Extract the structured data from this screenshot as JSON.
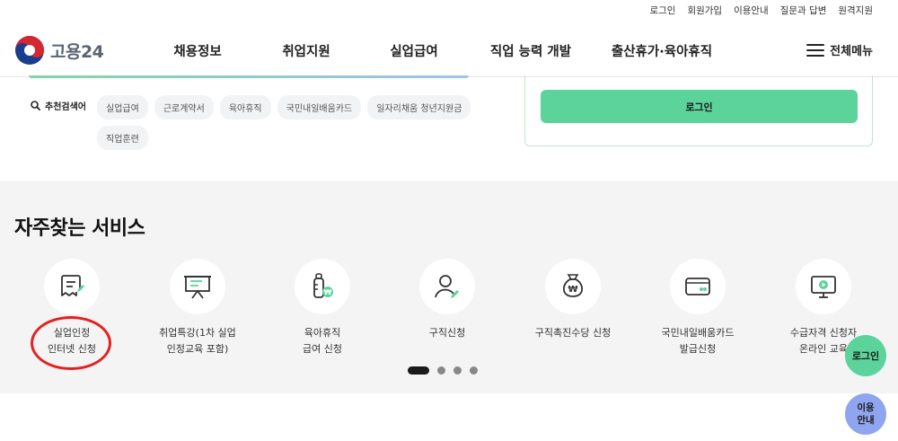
{
  "util_links": [
    "로그인",
    "회원가입",
    "이용안내",
    "질문과 답변",
    "원격지원"
  ],
  "logo": {
    "text": "고용24"
  },
  "gnb": [
    "채용정보",
    "취업지원",
    "실업급여",
    "직업 능력 개발",
    "출산휴가·육아휴직"
  ],
  "all_menu_label": "전체메뉴",
  "recommend": {
    "label": "추천검색어",
    "tags": [
      "실업급여",
      "근로계약서",
      "육아휴직",
      "국민내일배움카드",
      "일자리채움 청년지원금",
      "직업훈련"
    ]
  },
  "login_box": {
    "button_label": "로그인"
  },
  "services": {
    "title": "자주찾는 서비스",
    "items": [
      {
        "label": "실업인정\n인터넷 신청",
        "icon": "document-edit-icon"
      },
      {
        "label": "취업특강(1차 실업\n인정교육 포함)",
        "icon": "presentation-board-icon"
      },
      {
        "label": "육아휴직\n급여 신청",
        "icon": "baby-bottle-won-icon"
      },
      {
        "label": "구직신청",
        "icon": "person-edit-icon"
      },
      {
        "label": "구직촉진수당 신청",
        "icon": "money-bag-won-icon"
      },
      {
        "label": "국민내일배움카드\n발급신청",
        "icon": "card-icon"
      },
      {
        "label": "수급자격 신청자\n온라인 교육",
        "icon": "monitor-play-icon"
      }
    ],
    "pagination": {
      "pages": 4,
      "active": 1
    }
  },
  "floating": {
    "login_label": "로그인",
    "guide_label": "이용\n안내"
  },
  "colors": {
    "accent_green": "#5dd39c",
    "highlight_red": "#e52020",
    "guide_blue": "#8fa5ef"
  }
}
